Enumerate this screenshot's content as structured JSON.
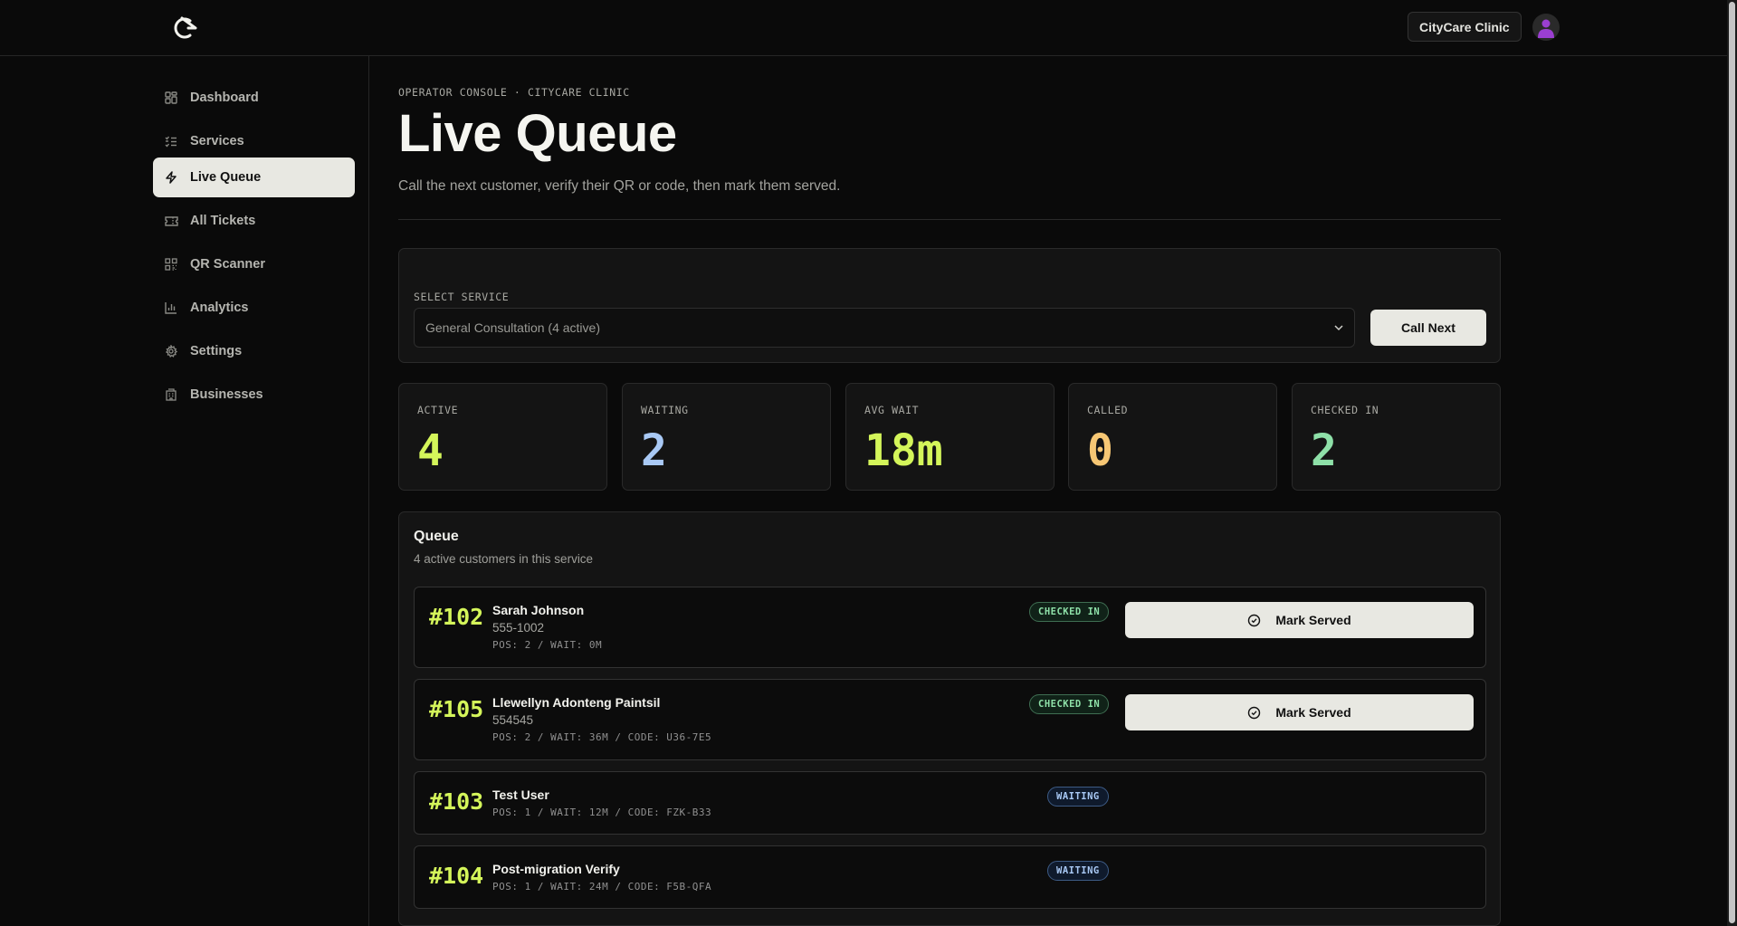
{
  "header": {
    "clinic_name": "CityCare Clinic"
  },
  "sidebar": {
    "items": [
      {
        "label": "Dashboard",
        "icon": "dashboard-icon"
      },
      {
        "label": "Services",
        "icon": "list-check-icon"
      },
      {
        "label": "Live Queue",
        "icon": "lightning-icon",
        "active": true
      },
      {
        "label": "All Tickets",
        "icon": "ticket-icon"
      },
      {
        "label": "QR Scanner",
        "icon": "qr-code-icon"
      },
      {
        "label": "Analytics",
        "icon": "bar-chart-icon"
      },
      {
        "label": "Settings",
        "icon": "gear-icon"
      },
      {
        "label": "Businesses",
        "icon": "building-icon"
      }
    ]
  },
  "page": {
    "eyebrow": "OPERATOR CONSOLE · CITYCARE CLINIC",
    "title": "Live Queue",
    "subtitle": "Call the next customer, verify their QR or code, then mark them served."
  },
  "service": {
    "label": "SELECT SERVICE",
    "selected": "General Consultation (4 active)",
    "call_next_label": "Call Next"
  },
  "stats": [
    {
      "label": "ACTIVE",
      "value": "4",
      "color": "#d4f55a"
    },
    {
      "label": "WAITING",
      "value": "2",
      "color": "#a9c9f5"
    },
    {
      "label": "AVG WAIT",
      "value": "18m",
      "color": "#d4f55a"
    },
    {
      "label": "CALLED",
      "value": "0",
      "color": "#f7c774"
    },
    {
      "label": "CHECKED IN",
      "value": "2",
      "color": "#8ee0a8"
    }
  ],
  "queue": {
    "title": "Queue",
    "subtitle": "4 active customers in this service",
    "mark_served_label": "Mark Served",
    "tickets": [
      {
        "number": "#102",
        "name": "Sarah Johnson",
        "phone": "555-1002",
        "meta": "POS: 2 / WAIT: 0M",
        "status": "CHECKED IN"
      },
      {
        "number": "#105",
        "name": "Llewellyn Adonteng Paintsil",
        "phone": "554545",
        "meta": "POS: 2 / WAIT: 36M / CODE: U36-7E5",
        "status": "CHECKED IN"
      },
      {
        "number": "#103",
        "name": "Test User",
        "phone": "",
        "meta": "POS: 1 / WAIT: 12M / CODE: FZK-B33",
        "status": "WAITING"
      },
      {
        "number": "#104",
        "name": "Post-migration Verify",
        "phone": "",
        "meta": "POS: 1 / WAIT: 24M / CODE: F5B-QFA",
        "status": "WAITING"
      }
    ]
  }
}
